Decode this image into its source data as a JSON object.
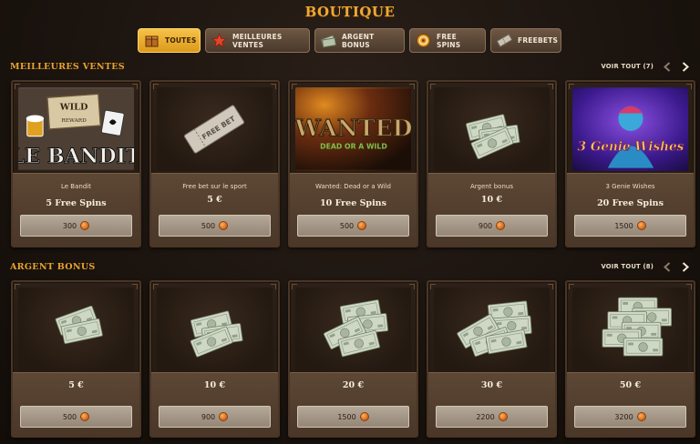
{
  "page": {
    "title": "BOUTIQUE"
  },
  "tabs": [
    {
      "label": "TOUTES",
      "icon": "crate-icon",
      "active": true
    },
    {
      "label": "MEILLEURES VENTES",
      "icon": "star-icon",
      "active": false
    },
    {
      "label": "ARGENT BONUS",
      "icon": "cash-icon",
      "active": false
    },
    {
      "label": "FREE SPINS",
      "icon": "spin-icon",
      "active": false
    },
    {
      "label": "FREEBETS",
      "icon": "ticket-icon",
      "active": false
    }
  ],
  "sections": [
    {
      "title": "MEILLEURES VENTES",
      "see_all": "VOIR TOUT (7)",
      "items": [
        {
          "name": "Le Bandit",
          "prize": "5 Free Spins",
          "price": "300",
          "image_text": "LE BANDIT"
        },
        {
          "name": "Free bet sur le sport",
          "prize": "5 €",
          "price": "500",
          "image_text": "FREE BET"
        },
        {
          "name": "Wanted: Dead or a Wild",
          "prize": "10 Free Spins",
          "price": "500",
          "image_text": "WANTED",
          "image_subtext": "DEAD OR A WILD"
        },
        {
          "name": "Argent bonus",
          "prize": "10 €",
          "price": "900"
        },
        {
          "name": "3 Genie Wishes",
          "prize": "20 Free Spins",
          "price": "1500",
          "image_text": "3 Genie Wishes"
        }
      ]
    },
    {
      "title": "ARGENT BONUS",
      "see_all": "VOIR TOUT (8)",
      "items": [
        {
          "prize": "5 €",
          "price": "500"
        },
        {
          "prize": "10 €",
          "price": "900"
        },
        {
          "prize": "20 €",
          "price": "1500"
        },
        {
          "prize": "30 €",
          "price": "2200"
        },
        {
          "prize": "50 €",
          "price": "3200"
        }
      ]
    }
  ],
  "colors": {
    "accent": "#f0a830",
    "tab_active": "#f6c248",
    "coin": "#d0641c"
  }
}
